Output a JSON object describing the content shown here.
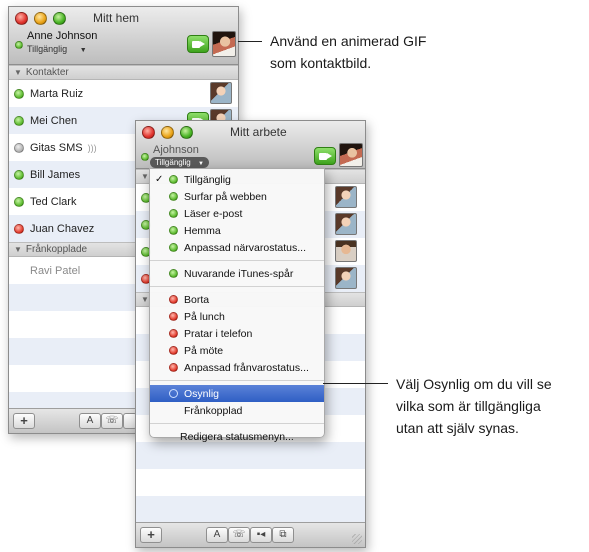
{
  "window_home": {
    "title": "Mitt hem",
    "user_name": "Anne Johnson",
    "user_status": "Tillgänglig",
    "groups": [
      {
        "label": "Kontakter",
        "contacts": [
          {
            "name": "Marta Ruiz",
            "status": "green"
          },
          {
            "name": "Mei Chen",
            "status": "green"
          },
          {
            "name": "Gitas SMS",
            "status": "gray"
          },
          {
            "name": "Bill James",
            "status": "green"
          },
          {
            "name": "Ted Clark",
            "status": "green"
          },
          {
            "name": "Juan Chavez",
            "status": "red"
          }
        ]
      },
      {
        "label": "Frånkopplade",
        "contacts": [
          {
            "name": "Ravi Patel",
            "status": "offline"
          }
        ]
      }
    ],
    "toolbar": {
      "add": "+",
      "text_btn": "A",
      "phone_btn": "☏"
    }
  },
  "window_work": {
    "title": "Mitt arbete",
    "user_name": "Ajohnson",
    "user_status": "Tillgänglig",
    "toolbar": {
      "add": "+",
      "text_btn": "A",
      "phone_btn": "☏",
      "video_btn": "▪◂",
      "screen_btn": "⧉"
    }
  },
  "status_menu": {
    "available": [
      {
        "label": "Tillgänglig",
        "checked": true
      },
      {
        "label": "Surfar på webben"
      },
      {
        "label": "Läser e-post"
      },
      {
        "label": "Hemma"
      },
      {
        "label": "Anpassad närvarostatus..."
      }
    ],
    "itunes": {
      "label": "Nuvarande iTunes-spår"
    },
    "away": [
      {
        "label": "Borta"
      },
      {
        "label": "På lunch"
      },
      {
        "label": "Pratar i telefon"
      },
      {
        "label": "På möte"
      },
      {
        "label": "Anpassad frånvarostatus..."
      }
    ],
    "invisible": {
      "label": "Osynlig"
    },
    "offline": {
      "label": "Frånkopplad"
    },
    "edit": {
      "label": "Redigera statusmenyn..."
    }
  },
  "callouts": {
    "gif_line1": "Använd en animerad GIF",
    "gif_line2": "som kontaktbild.",
    "invisible_line1": "Välj Osynlig om du vill se",
    "invisible_line2": "vilka som är tillgängliga",
    "invisible_line3": "utan att själv synas."
  },
  "colors": {
    "available": "#5dbb2f",
    "away": "#e23a2c",
    "idle": "#b4b4b4",
    "selection": "#2f5fc4"
  }
}
